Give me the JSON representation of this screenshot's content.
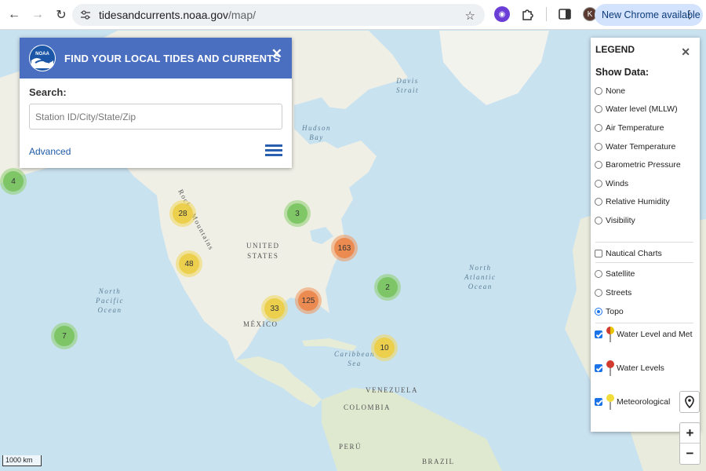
{
  "browser": {
    "url_domain": "tidesandcurrents.noaa.gov",
    "url_path": "/map/",
    "update_button": "New Chrome available",
    "profile_initial": "K",
    "icons": [
      "back-arrow-icon",
      "forward-arrow-icon",
      "reload-icon",
      "site-info-icon",
      "star-icon",
      "extension-icon",
      "puzzle-icon",
      "side-panel-icon",
      "kebab-menu-icon"
    ]
  },
  "search_panel": {
    "title": "FIND YOUR LOCAL TIDES AND CURRENTS",
    "close": "✕",
    "search_label": "Search:",
    "placeholder": "Station ID/City/State/Zip",
    "advanced_link": "Advanced",
    "logo_text": "NOAA"
  },
  "legend": {
    "title": "LEGEND",
    "close": "✕",
    "show_data_label": "Show Data:",
    "data_options": [
      {
        "label": "None",
        "selected": false
      },
      {
        "label": "Water level (MLLW)",
        "selected": false
      },
      {
        "label": "Air Temperature",
        "selected": false
      },
      {
        "label": "Water Temperature",
        "selected": false
      },
      {
        "label": "Barometric Pressure",
        "selected": false
      },
      {
        "label": "Winds",
        "selected": false
      },
      {
        "label": "Relative Humidity",
        "selected": false
      },
      {
        "label": "Visibility",
        "selected": false
      }
    ],
    "nautical_charts": {
      "label": "Nautical Charts",
      "checked": false
    },
    "basemaps": [
      {
        "label": "Satellite",
        "selected": false
      },
      {
        "label": "Streets",
        "selected": false
      },
      {
        "label": "Topo",
        "selected": true
      }
    ],
    "layers": [
      {
        "label": "Water Level and Met",
        "checked": true,
        "pin": "multicolor"
      },
      {
        "label": "Water Levels",
        "checked": true,
        "pin": "red"
      },
      {
        "label": "Meteorological",
        "checked": true,
        "pin": "yellow"
      }
    ]
  },
  "map": {
    "labels": {
      "davis_strait": "Davis\nStrait",
      "hudson_bay": "Hudson\nBay",
      "rocky_mountains": "Rocky Mountains",
      "united_states": "UNITED\nSTATES",
      "north_pacific": "North\nPacific\nOcean",
      "north_atlantic": "North\nAtlantic\nOcean",
      "mexico": "MÉXICO",
      "caribbean": "Caribbean\nSea",
      "venezuela": "VENEZUELA",
      "colombia": "COLOMBIA",
      "peru": "PERÚ",
      "brazil": "BRAZIL"
    },
    "clusters": [
      {
        "count": "4",
        "color": "green"
      },
      {
        "count": "28",
        "color": "yellow"
      },
      {
        "count": "3",
        "color": "green"
      },
      {
        "count": "163",
        "color": "orange"
      },
      {
        "count": "48",
        "color": "yellow"
      },
      {
        "count": "2",
        "color": "green"
      },
      {
        "count": "125",
        "color": "orange"
      },
      {
        "count": "33",
        "color": "yellow"
      },
      {
        "count": "7",
        "color": "green"
      },
      {
        "count": "10",
        "color": "yellow"
      }
    ],
    "scale_bar": "1000 km",
    "zoom_in": "+",
    "zoom_out": "−"
  }
}
